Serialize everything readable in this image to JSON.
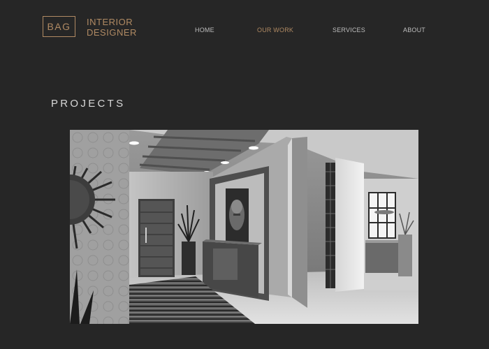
{
  "brand": {
    "logo_mark": "BAG",
    "name_line1": "INTERIOR",
    "name_line2": "DESIGNER"
  },
  "nav": {
    "items": [
      {
        "label": "HOME"
      },
      {
        "label": "OUR WORK",
        "active": true
      },
      {
        "label": "SERVICES"
      },
      {
        "label": "ABOUT"
      }
    ]
  },
  "main": {
    "section_title": "PROJECTS"
  },
  "colors": {
    "background": "#262626",
    "accent": "#b08a63",
    "nav_text": "#bdbdbd"
  }
}
